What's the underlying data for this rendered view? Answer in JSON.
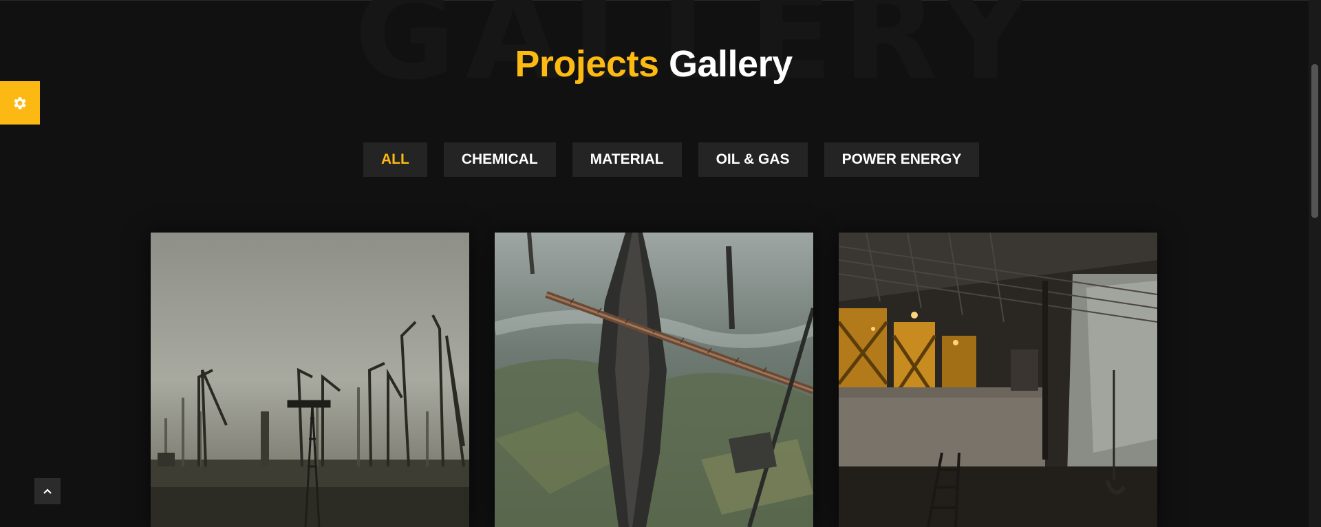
{
  "background_word": "GALLERY",
  "heading": {
    "accent": "Projects",
    "rest": "Gallery"
  },
  "filters": [
    {
      "label": "ALL",
      "active": true
    },
    {
      "label": "CHEMICAL",
      "active": false
    },
    {
      "label": "MATERIAL",
      "active": false
    },
    {
      "label": "OIL & GAS",
      "active": false
    },
    {
      "label": "POWER ENERGY",
      "active": false
    }
  ],
  "icons": {
    "settings": "gear-icon",
    "scroll_top": "chevron-up-icon"
  },
  "colors": {
    "accent": "#fdba13",
    "background": "#111111",
    "button_bg": "#242424",
    "text": "#ffffff"
  }
}
